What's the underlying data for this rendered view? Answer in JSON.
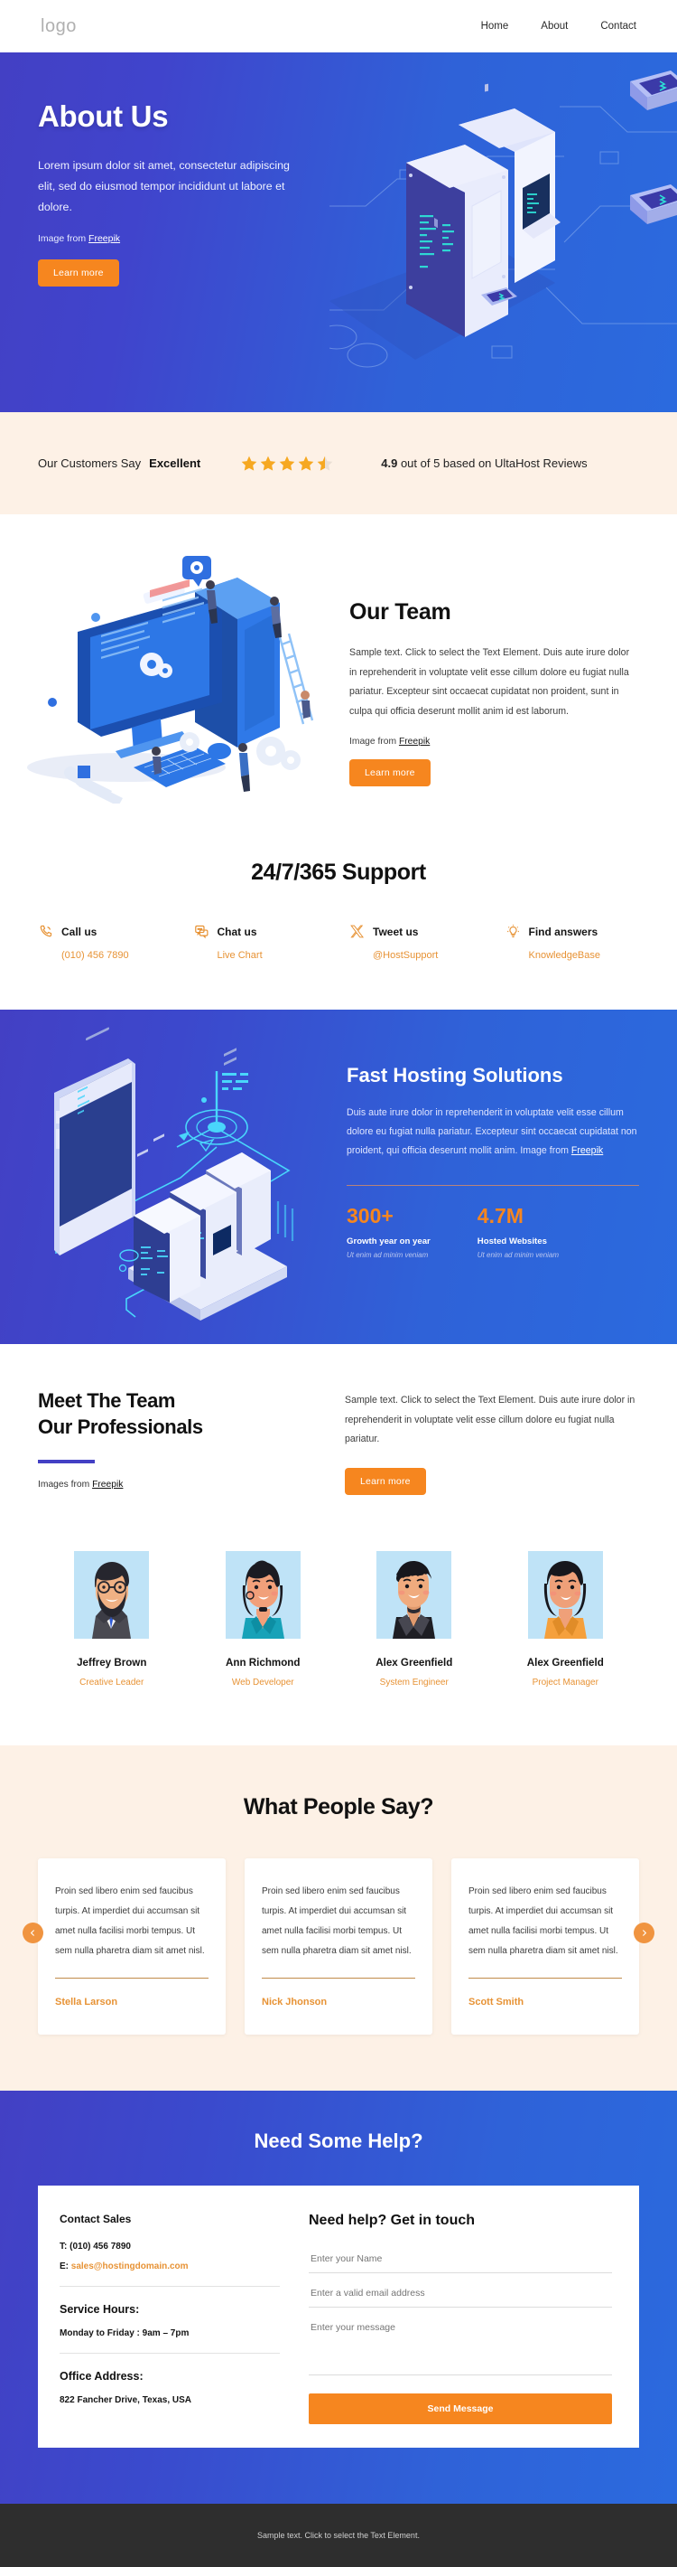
{
  "nav": {
    "logo": "logo",
    "links": [
      {
        "label": "Home"
      },
      {
        "label": "About"
      },
      {
        "label": "Contact"
      }
    ]
  },
  "hero": {
    "title": "About Us",
    "paragraph": "Lorem ipsum dolor sit amet, consectetur adipiscing elit, sed do eiusmod tempor incididunt ut labore et dolore.",
    "credit_prefix": "Image from ",
    "credit_link": "Freepik",
    "cta": "Learn more",
    "bg_start": "#4340c4",
    "bg_end": "#2b6ade"
  },
  "reviews": {
    "prefix": "Our Customers Say",
    "rating_word": "Excellent",
    "stars_full": 4,
    "stars_half": 1,
    "score": "4.9",
    "score_rest": " out of 5 based on UltaHost Reviews",
    "star_color": "#f6a821",
    "bg": "#fdf1e6"
  },
  "our_team": {
    "title": "Our Team",
    "paragraph": "Sample text. Click to select the Text Element. Duis aute irure dolor in reprehenderit in voluptate velit esse cillum dolore eu fugiat nulla pariatur. Excepteur sint occaecat cupidatat non proident, sunt in culpa qui officia deserunt mollit anim id est laborum.",
    "credit_prefix": "Image from ",
    "credit_link": "Freepik",
    "cta": "Learn more"
  },
  "support": {
    "title": "24/7/365 Support",
    "items": [
      {
        "icon": "phone-icon",
        "label": "Call us",
        "link": "(010) 456 7890"
      },
      {
        "icon": "chat-icon",
        "label": "Chat us",
        "link": "Live Chart"
      },
      {
        "icon": "x-twitter-icon",
        "label": "Tweet us",
        "link": "@HostSupport"
      },
      {
        "icon": "lightbulb-icon",
        "label": "Find answers",
        "link": "KnowledgeBase"
      }
    ],
    "accent": "#e79234"
  },
  "fast_hosting": {
    "title": "Fast Hosting Solutions",
    "paragraph": "Duis aute irure dolor in reprehenderit in voluptate velit esse cillum dolore eu fugiat nulla pariatur. Excepteur sint occaecat cupidatat non proident, qui officia deserunt mollit anim.  Image from ",
    "credit_link": "Freepik",
    "stats": [
      {
        "value": "300+",
        "label": "Growth year on year",
        "sub": "Ut enim ad minim veniam"
      },
      {
        "value": "4.7M",
        "label": "Hosted Websites",
        "sub": "Ut enim ad minim veniam"
      }
    ],
    "accent": "#f6861f"
  },
  "meet": {
    "title_line1": "Meet The Team",
    "title_line2": "Our Professionals",
    "credit_prefix": "Images from ",
    "credit_link": "Freepik",
    "paragraph": "Sample text. Click to select the Text Element. Duis aute irure dolor in reprehenderit in voluptate velit esse cillum dolore eu fugiat nulla pariatur.",
    "cta": "Learn more",
    "rule_color": "#4340c4"
  },
  "members": [
    {
      "name": "Jeffrey Brown",
      "role": "Creative Leader",
      "avatar": "avatar-bearded-man-glasses"
    },
    {
      "name": "Ann Richmond",
      "role": "Web Developer",
      "avatar": "avatar-woman-teal-top"
    },
    {
      "name": "Alex Greenfield",
      "role": "System Engineer",
      "avatar": "avatar-man-dark-jacket"
    },
    {
      "name": "Alex Greenfield",
      "role": "Project Manager",
      "avatar": "avatar-woman-orange-top"
    }
  ],
  "testimonials": {
    "title": "What People Say?",
    "prev_icon": "chevron-left-icon",
    "next_icon": "chevron-right-icon",
    "cards": [
      {
        "text": "Proin sed libero enim sed faucibus turpis. At imperdiet dui accumsan sit amet nulla facilisi morbi tempus. Ut sem nulla pharetra diam sit amet nisl.",
        "author": "Stella Larson"
      },
      {
        "text": "Proin sed libero enim sed faucibus turpis. At imperdiet dui accumsan sit amet nulla facilisi morbi tempus. Ut sem nulla pharetra diam sit amet nisl.",
        "author": "Nick Jhonson"
      },
      {
        "text": "Proin sed libero enim sed faucibus turpis. At imperdiet dui accumsan sit amet nulla facilisi morbi tempus. Ut sem nulla pharetra diam sit amet nisl.",
        "author": "Scott Smith"
      }
    ]
  },
  "help": {
    "title": "Need Some Help?",
    "contact_title": "Contact Sales",
    "phone_prefix": "T: ",
    "phone": "(010) 456 7890",
    "email_prefix": "E: ",
    "email": "sales@hostingdomain.com",
    "hours_title": "Service Hours:",
    "hours_value": "Monday to Friday : 9am – 7pm",
    "address_title": "Office Address:",
    "address_value": "822 Fancher Drive, Texas, USA",
    "form_title": "Need help? Get in touch",
    "name_placeholder": "Enter your Name",
    "email_placeholder": "Enter a valid email address",
    "message_placeholder": "Enter your message",
    "submit": "Send Message"
  },
  "footer": {
    "text": "Sample text. Click to select the Text Element.",
    "bg": "#2e2e2e"
  }
}
